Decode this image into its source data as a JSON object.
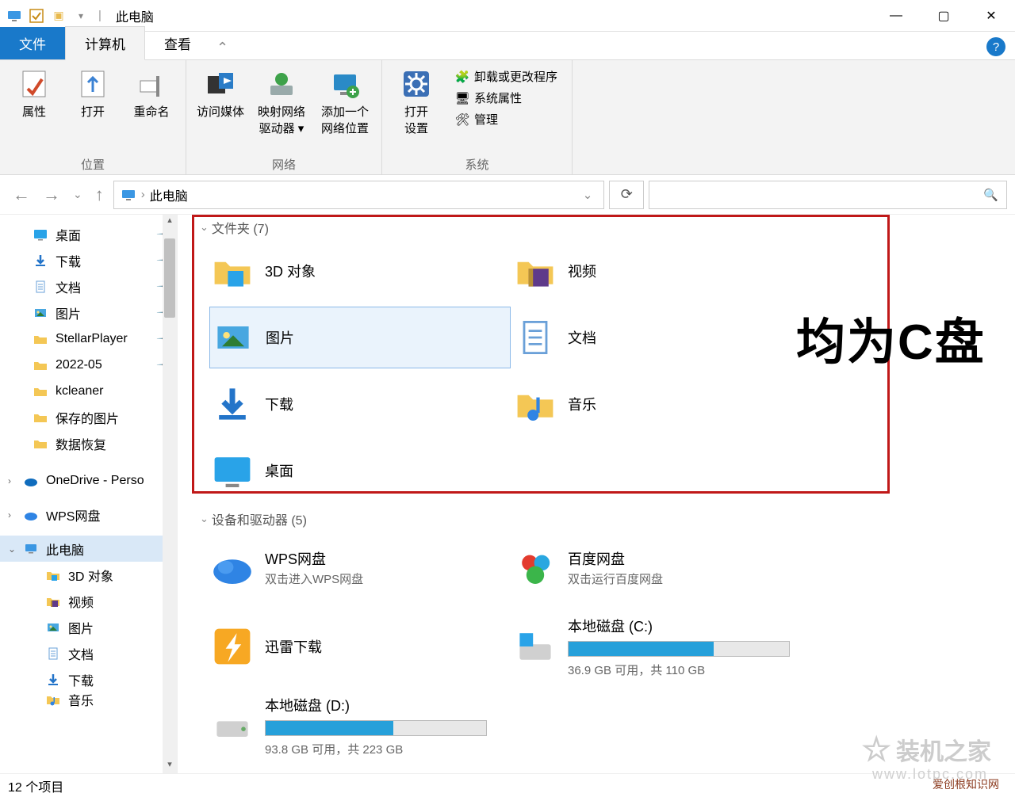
{
  "window": {
    "title": "此电脑",
    "min": "—",
    "max": "▢",
    "close": "✕"
  },
  "tabs": {
    "file": "文件",
    "computer": "计算机",
    "view": "查看"
  },
  "ribbon": {
    "location_group": "位置",
    "network_group": "网络",
    "system_group": "系统",
    "properties": "属性",
    "open": "打开",
    "rename": "重命名",
    "media": "访问媒体",
    "mapdrive": "映射网络\n驱动器 ▾",
    "addloc": "添加一个\n网络位置",
    "opensettings": "打开\n设置",
    "links": {
      "uninstall": "卸载或更改程序",
      "sysprops": "系统属性",
      "manage": "管理"
    }
  },
  "address": {
    "crumb": "此电脑",
    "search_placeholder": ""
  },
  "sidebar": {
    "items": [
      {
        "icon": "desktop",
        "label": "桌面",
        "pinned": true
      },
      {
        "icon": "download",
        "label": "下载",
        "pinned": true
      },
      {
        "icon": "doc",
        "label": "文档",
        "pinned": true
      },
      {
        "icon": "pics",
        "label": "图片",
        "pinned": true
      },
      {
        "icon": "folder",
        "label": "StellarPlayer",
        "pinned": true
      },
      {
        "icon": "folder",
        "label": "2022-05",
        "pinned": true
      },
      {
        "icon": "folder",
        "label": "kcleaner"
      },
      {
        "icon": "folder",
        "label": "保存的图片"
      },
      {
        "icon": "folder",
        "label": "数据恢复"
      }
    ],
    "groups": [
      {
        "icon": "onedrive",
        "label": "OneDrive - Perso"
      },
      {
        "icon": "wps",
        "label": "WPS网盘"
      },
      {
        "icon": "thispc",
        "label": "此电脑",
        "selected": true
      }
    ],
    "children": [
      {
        "icon": "3d",
        "label": "3D 对象"
      },
      {
        "icon": "video",
        "label": "视频"
      },
      {
        "icon": "pics",
        "label": "图片"
      },
      {
        "icon": "doc",
        "label": "文档"
      },
      {
        "icon": "download",
        "label": "下载"
      },
      {
        "icon": "music",
        "label": "音乐",
        "partial": true
      }
    ]
  },
  "content": {
    "folders_header": "文件夹 (7)",
    "folders": [
      {
        "label": "3D 对象",
        "icon": "3d"
      },
      {
        "label": "视频",
        "icon": "video"
      },
      {
        "label": "图片",
        "icon": "pics",
        "selected": true
      },
      {
        "label": "文档",
        "icon": "doc"
      },
      {
        "label": "下载",
        "icon": "download"
      },
      {
        "label": "音乐",
        "icon": "music"
      },
      {
        "label": "桌面",
        "icon": "desktop"
      }
    ],
    "devices_header": "设备和驱动器 (5)",
    "devices": [
      {
        "label": "WPS网盘",
        "sub": "双击进入WPS网盘",
        "icon": "wps-cloud"
      },
      {
        "label": "百度网盘",
        "sub": "双击运行百度网盘",
        "icon": "baidu"
      },
      {
        "label": "迅雷下载",
        "sub": "",
        "icon": "xunlei"
      },
      {
        "label": "本地磁盘 (C:)",
        "sub": "36.9 GB 可用，共 110 GB",
        "icon": "drive-win",
        "fill": 66
      },
      {
        "label": "本地磁盘 (D:)",
        "sub": "93.8 GB 可用，共 223 GB",
        "icon": "drive",
        "fill": 58
      }
    ]
  },
  "annotation": {
    "text": "均为C盘"
  },
  "status": {
    "text": "12 个项目"
  },
  "watermark": {
    "brand": "装机之家",
    "url": "www.lotpc.com",
    "source": "爱创根知识网"
  },
  "icons": {
    "pc": "🖥",
    "check": "✓",
    "folder": "📁",
    "sep": "|",
    "dropdown": "▾",
    "back": "←",
    "fwd": "→",
    "up": "↑",
    "refresh": "⟳",
    "search": "🔍",
    "pin": "📌",
    "chev_down": "⌄",
    "chev_right": "›"
  }
}
